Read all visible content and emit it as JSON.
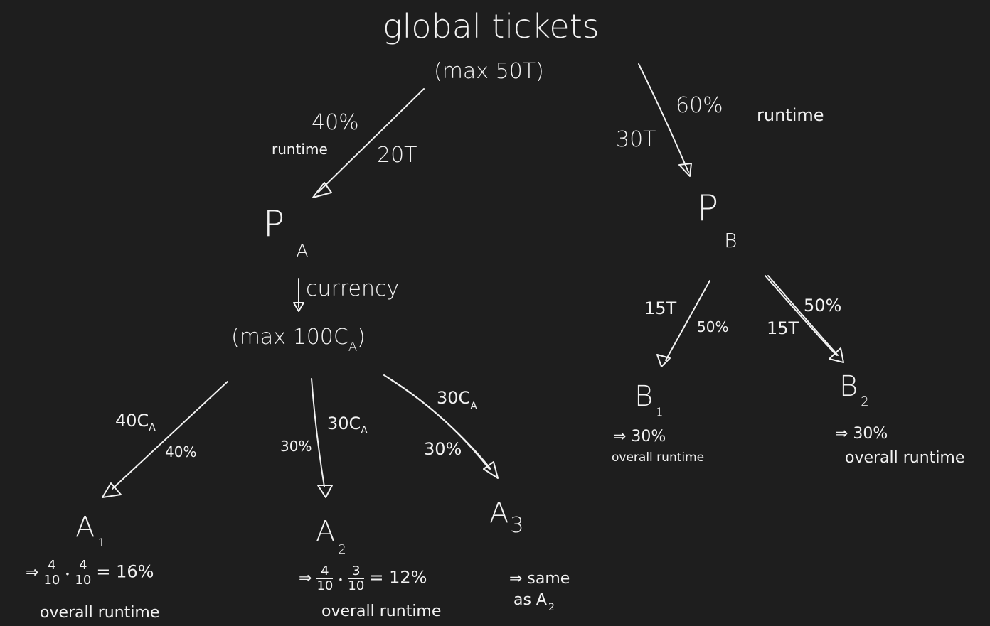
{
  "root": {
    "title": "global tickets",
    "subtitle": "(max 50T)"
  },
  "left_edge": {
    "percent": "40%",
    "runtime": "runtime",
    "tickets": "20T"
  },
  "right_edge": {
    "percent": "60%",
    "runtime": "runtime",
    "tickets": "30T"
  },
  "pa": {
    "letter": "P",
    "sub": "A",
    "currency_label": "currency",
    "currency_max": "(max 100C",
    "currency_sub": "A",
    "currency_close": ")"
  },
  "pb": {
    "letter": "P",
    "sub": "B"
  },
  "a_edges": [
    {
      "amount": "40C",
      "amount_sub": "A",
      "percent": "40%"
    },
    {
      "amount": "30C",
      "amount_sub": "A",
      "percent": "30%"
    },
    {
      "amount": "30C",
      "amount_sub": "A",
      "percent": "30%"
    }
  ],
  "b_edges": [
    {
      "tickets": "15T",
      "percent": "50%"
    },
    {
      "tickets": "15T",
      "percent": "50%"
    }
  ],
  "leaves": {
    "a1": {
      "letter": "A",
      "sub": "1",
      "arrow": "⇒",
      "f1_num": "4",
      "f1_den": "10",
      "dot": "•",
      "f2_num": "4",
      "f2_den": "10",
      "result": "= 16%",
      "caption": "overall runtime"
    },
    "a2": {
      "letter": "A",
      "sub": "2",
      "arrow": "⇒",
      "f1_num": "4",
      "f1_den": "10",
      "dot": "•",
      "f2_num": "3",
      "f2_den": "10",
      "result": "= 12%",
      "caption": "overall runtime"
    },
    "a3": {
      "letter": "A",
      "sub": "3",
      "note_line1": "⇒ same",
      "note_line2": "as A",
      "note_sub": "2"
    },
    "b1": {
      "letter": "B",
      "sub": "1",
      "result": "⇒ 30%",
      "caption": "overall runtime"
    },
    "b2": {
      "letter": "B",
      "sub": "2",
      "result": "⇒ 30%",
      "caption": "overall runtime"
    }
  }
}
